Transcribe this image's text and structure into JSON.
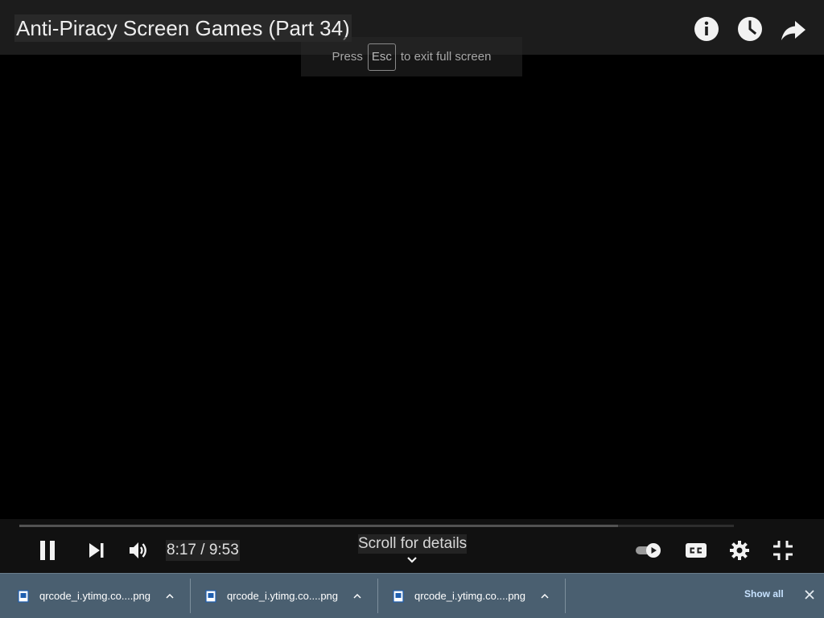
{
  "player": {
    "title": "Anti-Piracy Screen Games (Part 34)",
    "fullscreen_notice": {
      "press": "Press",
      "key": "Esc",
      "suffix": "to exit full screen"
    },
    "time_display": "8:17 / 9:53",
    "scroll_hint": "Scroll for details",
    "progress_fraction": 0.838,
    "top_icons": [
      "info-icon",
      "watch-later-icon",
      "share-icon"
    ],
    "control_icons": [
      "pause-icon",
      "next-icon",
      "volume-icon",
      "autoplay-toggle-icon",
      "captions-icon",
      "settings-icon",
      "exit-fullscreen-icon"
    ]
  },
  "downloads": {
    "items": [
      {
        "name": "qrcode_i.ytimg.co....png"
      },
      {
        "name": "qrcode_i.ytimg.co....png"
      },
      {
        "name": "qrcode_i.ytimg.co....png"
      }
    ],
    "show_all": "Show all"
  },
  "colors": {
    "download_bar": "#4a5f70",
    "show_all_link": "#c7e2ff"
  }
}
